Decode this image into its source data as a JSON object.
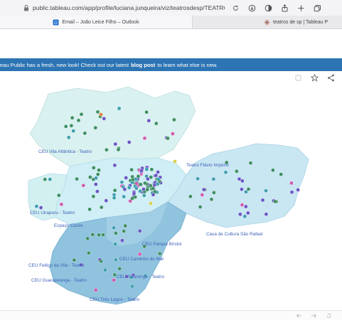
{
  "browser": {
    "url": "public.tableau.com/app/profile/luciana.junqueira/viz/teatrosdesp/TEATROSDE",
    "tabs": [
      {
        "label": "Email – João Leice Filho – Outlook"
      },
      {
        "label": "teatros de sp | Tableau P"
      }
    ]
  },
  "banner": {
    "text_before": "eau Public has a fresh, new look! Check out our latest",
    "link": "blog post",
    "text_after": "to learn what else is new."
  },
  "colors": {
    "banner": "#2c74b3",
    "label": "#3e63b8",
    "region_light": "#d9f1f0",
    "region_mid": "#c9e6f3",
    "region_dark": "#8fc3de",
    "dot_green": "#3f8f62",
    "dot_teal": "#3f9fb0",
    "dot_purple": "#6b57c4",
    "dot_pink": "#d05bb0",
    "dot_orange": "#e0833f",
    "dot_yellow": "#d7d24e"
  },
  "map": {
    "labels": [
      {
        "id": "vila-atlantica",
        "text": "CEU Vila Atlântica - Teatro"
      },
      {
        "id": "flavio-imperio",
        "text": "Teatro Flávio Império"
      },
      {
        "id": "uirapuru",
        "text": "CEU Uirapuru - Teatro"
      },
      {
        "id": "espaco-cuore",
        "text": "Espaço Cuore"
      },
      {
        "id": "sao-rafael",
        "text": "Casa de Cultura São Rafael"
      },
      {
        "id": "parque-bristol",
        "text": "CEU Parque Bristol"
      },
      {
        "id": "caminho-do-mar",
        "text": "CEU Caminho do Mar"
      },
      {
        "id": "feitico-da-vila",
        "text": "CEU Feitiço da Vila - Teatro"
      },
      {
        "id": "alvarenga",
        "text": "CEU Alvarenga - Teatro"
      },
      {
        "id": "guarapiranga",
        "text": "CEU Guarapiranga - Teatro"
      },
      {
        "id": "tres-lagos",
        "text": "CEU Três Lagos - Teatro"
      }
    ]
  }
}
